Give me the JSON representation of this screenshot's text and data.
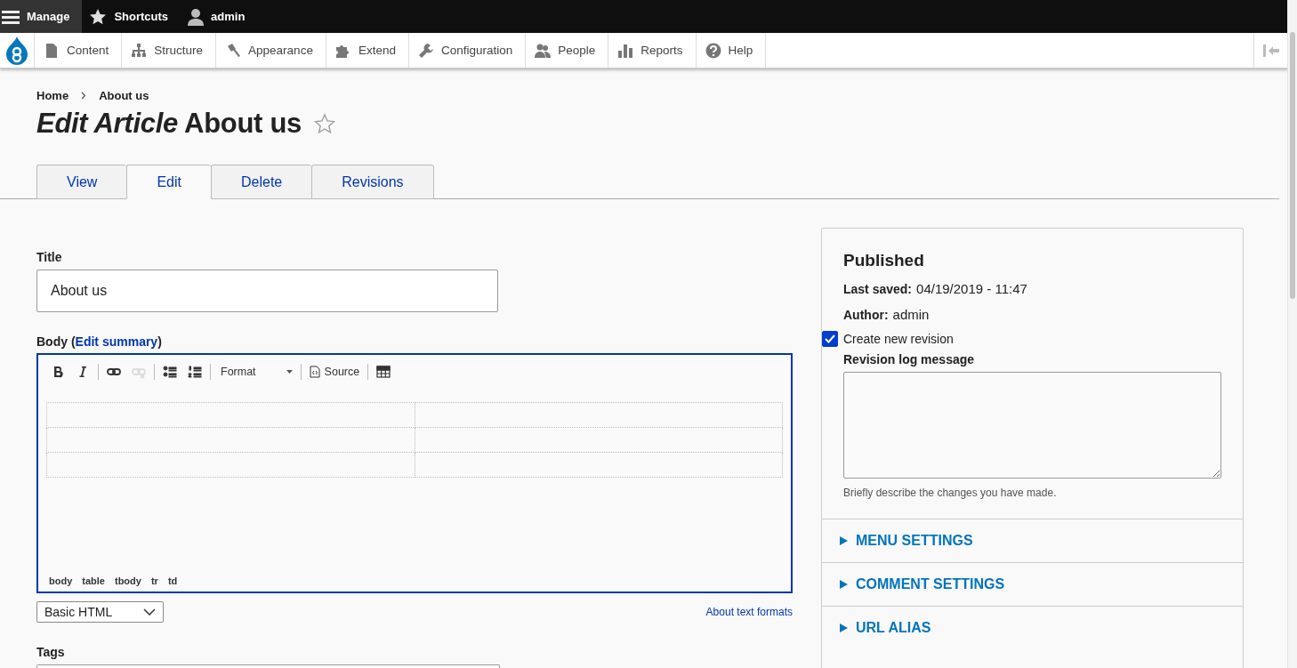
{
  "toolbar": {
    "items": [
      {
        "kind": "menu",
        "label": "Manage",
        "selected": true
      },
      {
        "kind": "star",
        "label": "Shortcuts",
        "selected": false
      },
      {
        "kind": "user",
        "label": "admin",
        "selected": false
      }
    ]
  },
  "admin_menu": {
    "items": [
      {
        "kind": "page",
        "label": "Content"
      },
      {
        "kind": "tree",
        "label": "Structure"
      },
      {
        "kind": "brush",
        "label": "Appearance"
      },
      {
        "kind": "puzzle",
        "label": "Extend"
      },
      {
        "kind": "wrench",
        "label": "Configuration"
      },
      {
        "kind": "people",
        "label": "People"
      },
      {
        "kind": "bars",
        "label": "Reports"
      },
      {
        "kind": "help",
        "label": "Help"
      }
    ]
  },
  "breadcrumb": [
    "Home",
    "About us"
  ],
  "page_title": "*Edit Article* About us",
  "tabs": [
    {
      "label": "View",
      "selected": false
    },
    {
      "label": "Edit",
      "selected": true
    },
    {
      "label": "Delete",
      "selected": false
    },
    {
      "label": "Revisions",
      "selected": false
    }
  ],
  "title_field": {
    "label": "Title",
    "value": "About us"
  },
  "body": {
    "label_start": "Body (",
    "link": "Edit summary",
    "label_end": ")",
    "tools": [
      {
        "kind": "bold",
        "disabled": false
      },
      {
        "kind": "italic",
        "disabled": false
      },
      {
        "kind": "separator"
      },
      {
        "kind": "link",
        "disabled": false
      },
      {
        "kind": "unlink",
        "disabled": true
      },
      {
        "kind": "separator"
      },
      {
        "kind": "bullets",
        "disabled": false
      },
      {
        "kind": "numbers",
        "disabled": false
      },
      {
        "kind": "separator"
      },
      {
        "kind": "format",
        "label": "Format"
      },
      {
        "kind": "separator"
      },
      {
        "kind": "source",
        "label": "Source"
      },
      {
        "kind": "separator"
      },
      {
        "kind": "table",
        "disabled": false
      }
    ],
    "path": [
      "body",
      "table",
      "tbody",
      "tr",
      "td"
    ],
    "format": "Basic HTML",
    "format_link": "About text formats"
  },
  "tags": {
    "label": "Tags"
  },
  "sidebar": {
    "status": "Published",
    "last_saved_label": "Last saved:",
    "last_saved": "04/19/2019 - 11:47",
    "author_label": "Author:",
    "author": "admin",
    "revision": {
      "label": "Create new revision",
      "checked": true
    },
    "log_label": "Revision log message",
    "log_hint": "Briefly describe the changes you have made.",
    "sections": [
      {
        "label": "MENU SETTINGS",
        "expanded": false
      },
      {
        "label": "COMMENT SETTINGS",
        "expanded": false
      },
      {
        "label": "URL ALIAS",
        "expanded": false
      }
    ]
  }
}
